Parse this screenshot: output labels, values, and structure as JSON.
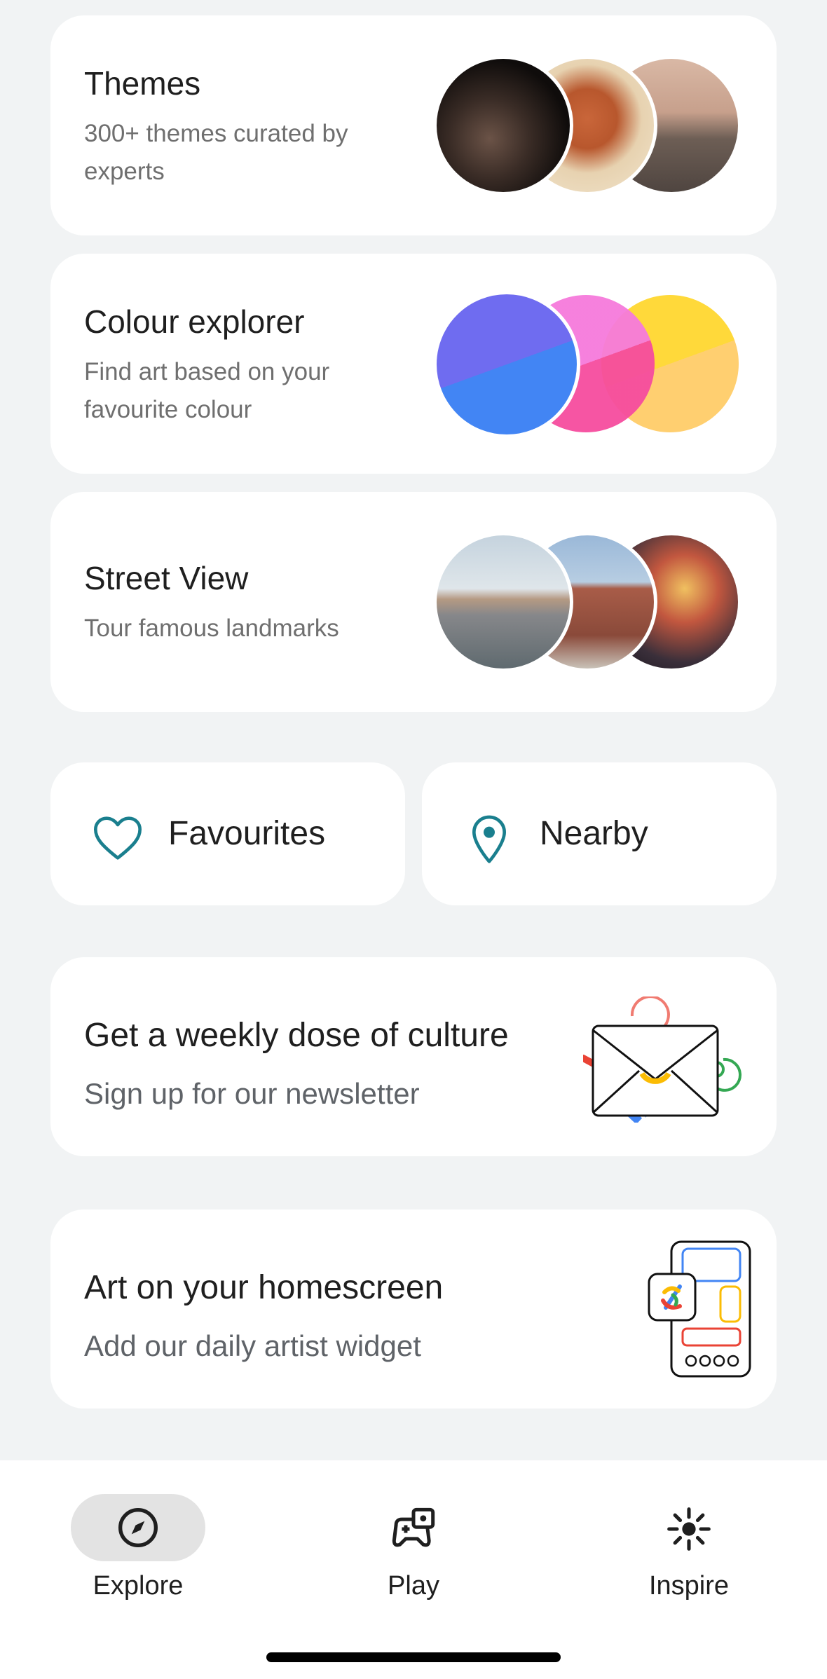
{
  "cards": {
    "themes": {
      "title": "Themes",
      "subtitle": "300+ themes curated by experts"
    },
    "colour": {
      "title": "Colour explorer",
      "subtitle": "Find art based on your favourite colour"
    },
    "street": {
      "title": "Street View",
      "subtitle": "Tour famous landmarks"
    }
  },
  "shortcuts": {
    "favourites": "Favourites",
    "nearby": "Nearby"
  },
  "promos": {
    "newsletter": {
      "title": "Get a weekly dose of culture",
      "subtitle": "Sign up for our newsletter"
    },
    "widget": {
      "title": "Art on your homescreen",
      "subtitle": "Add our daily artist widget"
    }
  },
  "nav": {
    "items": [
      {
        "label": "Explore",
        "icon": "compass-icon",
        "active": true
      },
      {
        "label": "Play",
        "icon": "gamepad-icon",
        "active": false
      },
      {
        "label": "Inspire",
        "icon": "sparkle-icon",
        "active": false
      }
    ]
  },
  "colors": {
    "accent_teal": "#1a7f8e",
    "background": "#f1f3f4",
    "active_pill": "#e3e3e3"
  }
}
